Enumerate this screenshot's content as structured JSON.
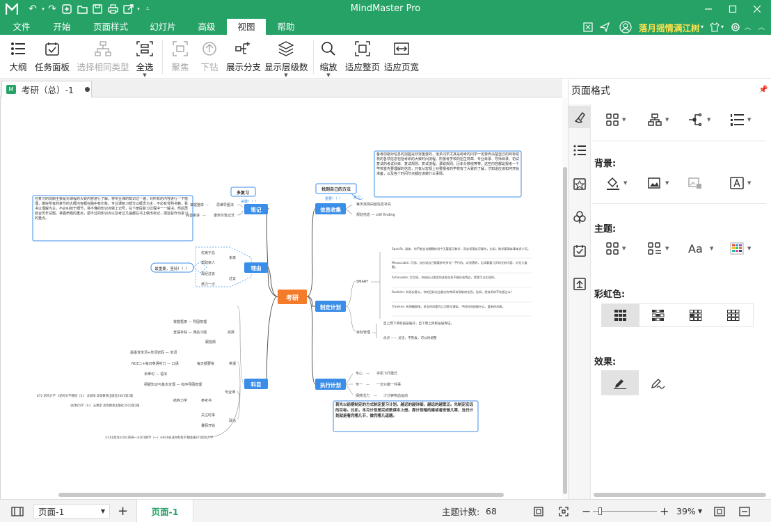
{
  "app": {
    "title": "MindMaster Pro",
    "brand_color": "#26a267"
  },
  "quick_access": [
    "undo-icon",
    "redo-icon",
    "new-icon",
    "open-icon",
    "save-icon",
    "print-icon",
    "export-icon",
    "more-icon"
  ],
  "menu": {
    "tabs": [
      "文件",
      "开始",
      "页面样式",
      "幻灯片",
      "高级",
      "视图",
      "帮助"
    ],
    "active": "视图",
    "user_name": "落月摇情满江树"
  },
  "ribbon": {
    "outline": "大纲",
    "task_panel": "任务面板",
    "select_same_type": "选择相同类型",
    "select_all": "全选",
    "focus": "聚焦",
    "drill_down": "下钻",
    "expand_branch": "展示分支",
    "show_levels": "显示层级数",
    "zoom": "缩放",
    "fit_page": "适应整页",
    "fit_width": "适应页宽"
  },
  "document": {
    "tab_name": "考研（总）-1"
  },
  "panel": {
    "title": "页面格式",
    "background_label": "背景:",
    "theme_label": "主题:",
    "rainbow_label": "彩虹色:",
    "effects_label": "效果:"
  },
  "status": {
    "page_select": "页面-1",
    "page_tab": "页面-1",
    "topic_count_label": "主题计数:",
    "topic_count": "68",
    "zoom": "39%"
  },
  "mindmap": {
    "center": "考研",
    "branches": {
      "notes": "笔记",
      "reason": "理由",
      "subjects": "科目",
      "info": "信息收集",
      "plan": "制定计划",
      "execute": "执行计划"
    },
    "float_review": "多复习",
    "float_review_sub": "关键！！！",
    "float_method": "找到自己的方法",
    "float_method_sub1": "重要！！！",
    "float_method_sub2": "复习",
    "callout_reason": "最重要，坚持！！！",
    "note_left": "在复习的前期主要是对课程的大致内容进行了解，将专业课的知识过一遍，对所有的内容进行一下梳理，做好所有的章节的大概内容都在脑中有印象。专业课复习部分以概念为主，不必有背熟书籍，看书以理解为主，不必纠结于细节，将不懂的知识点做上记号，在下册段复习过程中一一解决。然后再结合历年试题，掌握命题的重点，把不过的知识点以及考过几遍都在书上做出标记，把这些作为复习的重点。",
    "note_info": "备考前期对信息的把握是非常重要的，很多同学尤其是跨考的同学一定要弄清楚自己的目标院校的各项信息包括考研的大致时间流程、所报考学校的招生简章、专业目录、导师目录、初试复试的考试科目、复试规则、复试流程、录取规则、历年分数线等等，这些内容都是报考一个学校首先要理解的信息，只有从宏观上对要报考的学校有了大致的了解，才知道应该如何开始准备，以及各个时间节点都应该做什么事情。",
    "note_execute": "首先以前期制定的方式制定复习计划，越近的越详细，越远的越宽泛。先制定宏远的目标。比如，本月计划是完成数课本上册，周计划暗的建或者宏做几章，当日计划就是看完哪几节，做完哪几道题。",
    "notes_children": [
      {
        "a": "掌握整体",
        "b": "思维导图法"
      },
      {
        "a": "完善串讲",
        "b": "康奈尔笔记法"
      }
    ],
    "reason_children": [
      {
        "a": "优美于总",
        "b": "未来"
      },
      {
        "a": "帮助家人",
        "b": ""
      },
      {
        "a": "再经过去",
        "b": "过去"
      },
      {
        "a": "努力一次",
        "b": ""
      }
    ],
    "info_children": [
      "每天找将由给信息补充",
      "规划信息   —   still finding"
    ],
    "plan_smart": "SMART",
    "plan_smart_items": [
      "Specific: 具体、你不能含含糊糊的说今天要复习数学，而必须落实可操作，比如，数学要课本课本多少页。",
      "Measurable: 可测。仅仅说自己都要参考多长？不行的，必须落到，比如要看几页的天前内容，对完几道题。",
      "Achievable: 可实现。你给自己规定的这些任务不能好高骛远，得是可以实现的。",
      "Realistic: 有现实意义。你的目标应当能对你考研有帮助的东西，比如，把有用的不吃饭过么？",
      "Timeline: 有明确期限。多长时间要完几页数学课本，不同时间段做什么，要有时间表。"
    ],
    "plan_goal": "目标管理",
    "plan_goal_items": [
      "自上而下目标层层展开，自下而上目标层层保证。",
      "优点   ——   灵活、不死板，可以时调整"
    ],
    "execute_children": [
      {
        "a": "专心",
        "b": "手机飞行模式"
      },
      {
        "a": "专一",
        "b": "一次只做一件事"
      },
      {
        "a": "保持活力",
        "b": "少分钟热血运动"
      }
    ],
    "subjects_children": [
      {
        "label": "高数",
        "items": [
          "掌握框架   —   导图梳理",
          "查漏补缺   —   课后习题",
          "跟视频"
        ]
      },
      {
        "label": "英语",
        "items": [
          "墨墨背单词+单词密码   —   单词",
          "NCE二+每日英语听力   —   口语",
          "长难句   —   语法"
        ],
        "group": "每天都要练"
      },
      {
        "label": "专业课",
        "items": [
          "把握知识与基本定理   —   有序导图梳理",
          "872 结构力学  《结构力学教程（I）》 龙驭球 高等教育出版社2001第1版",
          "《结构力学（I）》 王焕定 高等教育出版社2010第3版"
        ],
        "group_a": "结构力学",
        "group_b": "参考书"
      },
      {
        "label": "政治",
        "items": [
          "关注时事",
          "暑假开始"
        ]
      },
      {
        "label": "",
        "items": [
          "①101政治②201英语一③301数学（一）④819农业材料科学基础或872结构力学"
        ]
      }
    ]
  }
}
